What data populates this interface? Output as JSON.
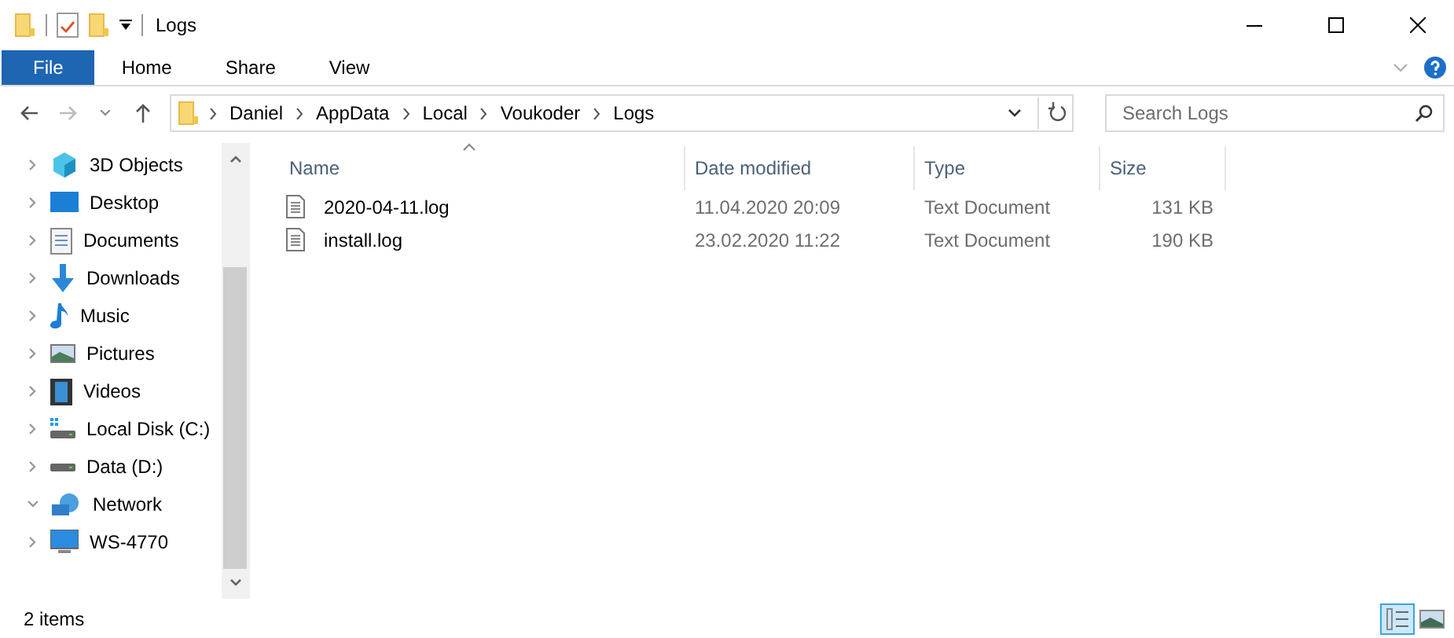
{
  "window": {
    "title": "Logs"
  },
  "ribbon": {
    "tabs": [
      {
        "label": "File",
        "selected": true
      },
      {
        "label": "Home",
        "selected": false
      },
      {
        "label": "Share",
        "selected": false
      },
      {
        "label": "View",
        "selected": false
      }
    ]
  },
  "address": {
    "path": [
      "Daniel",
      "AppData",
      "Local",
      "Voukoder",
      "Logs"
    ]
  },
  "search": {
    "placeholder": "Search Logs"
  },
  "sidebar": {
    "items": [
      {
        "label": "3D Objects",
        "expanded": false
      },
      {
        "label": "Desktop",
        "expanded": false
      },
      {
        "label": "Documents",
        "expanded": false
      },
      {
        "label": "Downloads",
        "expanded": false
      },
      {
        "label": "Music",
        "expanded": false
      },
      {
        "label": "Pictures",
        "expanded": false
      },
      {
        "label": "Videos",
        "expanded": false
      },
      {
        "label": "Local Disk (C:)",
        "expanded": false
      },
      {
        "label": "Data (D:)",
        "expanded": false
      },
      {
        "label": "Network",
        "expanded": true,
        "children": [
          {
            "label": "WS-4770",
            "expanded": false
          }
        ]
      }
    ]
  },
  "table": {
    "columns": [
      {
        "label": "Name",
        "sorted": true
      },
      {
        "label": "Date modified",
        "sorted": false
      },
      {
        "label": "Type",
        "sorted": false
      },
      {
        "label": "Size",
        "sorted": false
      }
    ],
    "rows": [
      {
        "name": "2020-04-11.log",
        "date": "11.04.2020 20:09",
        "type": "Text Document",
        "size": "131 KB"
      },
      {
        "name": "install.log",
        "date": "23.02.2020 11:22",
        "type": "Text Document",
        "size": "190 KB"
      }
    ]
  },
  "status_bar": {
    "count": "2 items",
    "views": [
      {
        "selected": true
      },
      {
        "selected": false
      }
    ]
  }
}
